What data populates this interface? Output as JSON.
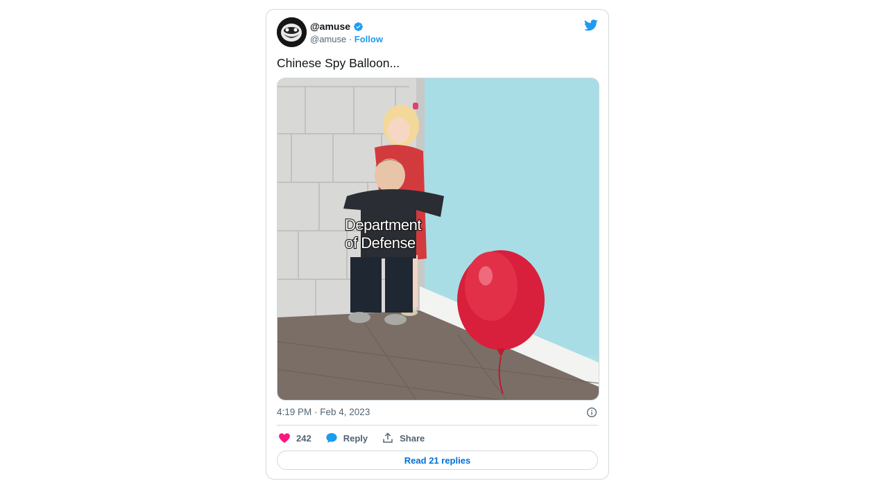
{
  "tweet": {
    "display_name": "@amuse",
    "handle": "@amuse",
    "handle_separator": " · ",
    "follow_label": "Follow",
    "text": "Chinese Spy Balloon...",
    "media_caption_line1": "Department",
    "media_caption_line2": "of Defense",
    "timestamp": "4:19 PM · Feb 4, 2023",
    "likes_count": "242",
    "reply_label": "Reply",
    "share_label": "Share",
    "read_replies_label": "Read 21 replies"
  },
  "icons": {
    "avatar": "avatar-image",
    "verified": "verified-badge-icon",
    "brand": "twitter-bird-icon",
    "info": "info-icon",
    "like": "heart-icon",
    "reply": "speech-bubble-icon",
    "share": "share-upload-icon"
  },
  "colors": {
    "accent": "#1d9bf0",
    "link": "#006fd6",
    "like": "#f91880",
    "muted_text": "#536471",
    "border": "#cfd9de"
  }
}
